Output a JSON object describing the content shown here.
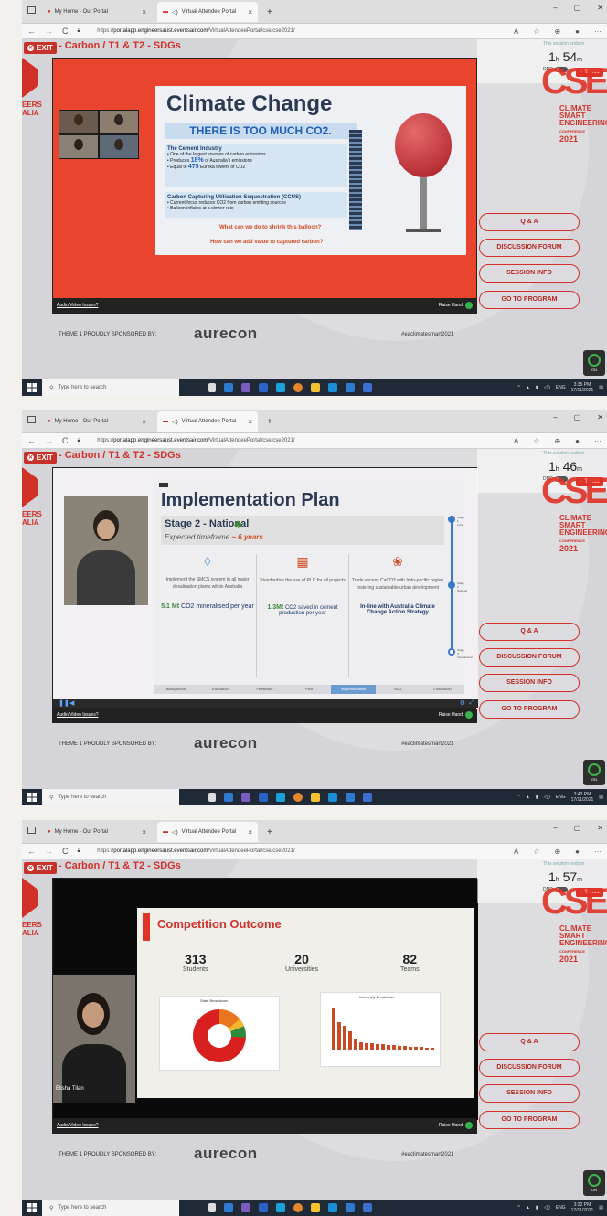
{
  "browser": {
    "tab1": "My Home - Our Portal",
    "tab2": "Virtual Attendee Portal",
    "url_prefix": "https://",
    "url_host": "portalapp.engineersaust.eventsair.com",
    "url_path": "/VirtualAttendeePortal/cse/cse2021/",
    "new_tab": "+"
  },
  "common": {
    "exit": "EXIT",
    "breadcrumb": "- Carbon / T1 & T2 - SDGs",
    "timer_label": "This session ends in",
    "dnd": "DND",
    "bell": "29000",
    "conf_line1": "CLIMATE",
    "conf_line2": "SMART",
    "conf_line3": "ENGINEERING",
    "conf_line4": "CONFERENCE",
    "conf_year": "2021",
    "left_logo_text1": "EERS",
    "left_logo_text2": "ALIA",
    "buttons": [
      "Q & A",
      "DISCUSSION FORUM",
      "SESSION INFO",
      "GO TO PROGRAM"
    ],
    "audio_issues": "Audio/Video Issues?",
    "raise_hand": "Raise Hand",
    "sponsor": "THEME 1 PROUDLY SPONSORED BY:",
    "sponsor_logo": "aurecon",
    "hashtag": "#eaclimatesmart2021",
    "on": "ON",
    "search": "Type here to search",
    "lang": "ENG"
  },
  "shots": [
    {
      "timer_h": "1",
      "timer_m": "54",
      "clock_time": "3:35 PM",
      "clock_date": "17/11/2021",
      "slide": {
        "title": "Climate Change",
        "banner": "THERE IS TOO MUCH CO2.",
        "section1": "The Cement Industry",
        "b1": "One of the largest sources of carbon emissions",
        "b2a": "Produces",
        "b2b": "18%",
        "b2c": "of Australia's emissions",
        "b3a": "Equal to",
        "b3b": "475",
        "b3c": "Eureka towers of CO2",
        "section2": "Carbon Capturing Utilisation Sequestration (CCUS)",
        "c1": "Current focus reduces CO2 from carbon emitting sources",
        "c2": "Balloon inflates at a slower rate",
        "q1": "What can we do to shrink this balloon?",
        "q2": "How can we add value to captured carbon?"
      }
    },
    {
      "timer_h": "1",
      "timer_m": "46",
      "clock_time": "3:43 PM",
      "clock_date": "17/11/2021",
      "slide": {
        "title": "Implementation Plan",
        "stage": "Stage 2 - National",
        "timeframe": "Expected timeframe",
        "years": "~ 6 years",
        "col1": "Implement the SMCS system to all major desalination plants within Australia",
        "col2": "Standardise the use of PLC for all projects",
        "col3": "Trade excess CaCO3 with Indo-pacific region fostering sustainable urban development",
        "stat1a": "5.1 Mt",
        "stat1b": "CO2 mineralised per year",
        "stat2a": "1.3Mt",
        "stat2b": "CO2 saved in cement production per year",
        "stat3": "In-line with Australia Climate Change Action Strategy",
        "stage1": "Stage 1 Local",
        "stage2n": "Stage 2 National",
        "stage3": "Stage 3 International",
        "nav": [
          "Background",
          "Education",
          "Feasibility",
          "Pilot",
          "Implementation",
          "SDG",
          "Conclusion"
        ]
      }
    },
    {
      "timer_h": "1",
      "timer_m": "57",
      "clock_time": "3:32 PM",
      "clock_date": "17/11/2021",
      "presenter": "Elisha Tilan",
      "slide": {
        "title": "Competition Outcome",
        "s1v": "313",
        "s1l": "Students",
        "s2v": "20",
        "s2l": "Universities",
        "s3v": "82",
        "s3l": "Teams",
        "pie_title": "State Breakdown",
        "bar_title": "University Breakdown"
      }
    }
  ]
}
